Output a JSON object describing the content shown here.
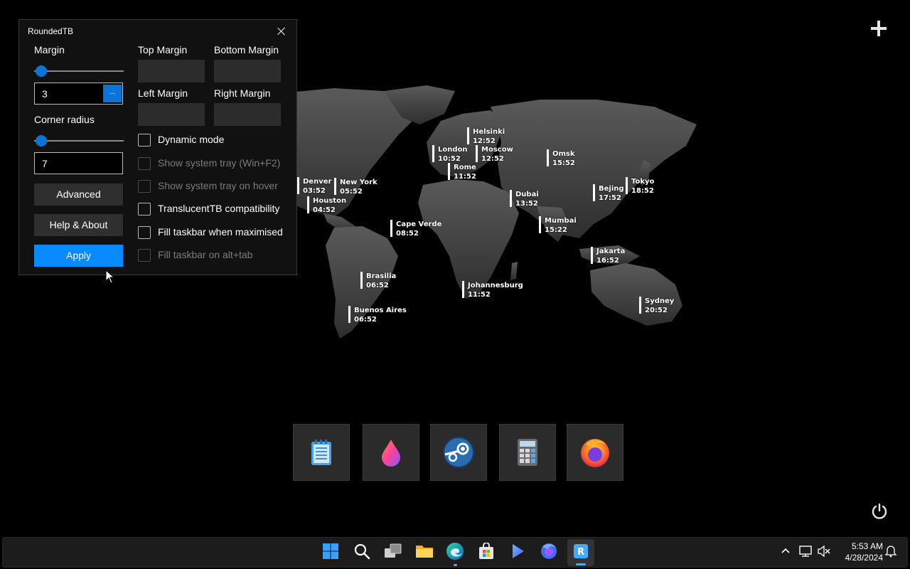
{
  "window": {
    "title": "RoundedTB",
    "margin_label": "Margin",
    "margin_value": "3",
    "margin_more_button": "...",
    "corner_radius_label": "Corner radius",
    "corner_radius_value": "7",
    "advanced_button": "Advanced",
    "help_button": "Help & About",
    "apply_button": "Apply",
    "top_margin_label": "Top Margin",
    "bottom_margin_label": "Bottom Margin",
    "left_margin_label": "Left Margin",
    "right_margin_label": "Right Margin",
    "options": [
      {
        "label": "Dynamic mode",
        "enabled": true,
        "checked": false
      },
      {
        "label": "Show system tray (Win+F2)",
        "enabled": false,
        "checked": false
      },
      {
        "label": "Show system tray on hover",
        "enabled": false,
        "checked": false
      },
      {
        "label": "TranslucentTB compatibility",
        "enabled": true,
        "checked": false
      },
      {
        "label": "Fill taskbar when maximised",
        "enabled": true,
        "checked": false
      },
      {
        "label": "Fill taskbar on alt+tab",
        "enabled": false,
        "checked": false
      }
    ]
  },
  "world_clock": [
    {
      "city": "Helsinki",
      "time": "12:52"
    },
    {
      "city": "London",
      "time": "10:52"
    },
    {
      "city": "Moscow",
      "time": "12:52"
    },
    {
      "city": "Omsk",
      "time": "15:52"
    },
    {
      "city": "Rome",
      "time": "11:52"
    },
    {
      "city": "Denver",
      "time": "03:52"
    },
    {
      "city": "New York",
      "time": "05:52"
    },
    {
      "city": "Tokyo",
      "time": "18:52"
    },
    {
      "city": "Bejing",
      "time": "17:52"
    },
    {
      "city": "Dubai",
      "time": "13:52"
    },
    {
      "city": "Houston",
      "time": "04:52"
    },
    {
      "city": "Cape Verde",
      "time": "08:52"
    },
    {
      "city": "Mumbai",
      "time": "15:22"
    },
    {
      "city": "Jakarta",
      "time": "16:52"
    },
    {
      "city": "Brasilia",
      "time": "06:52"
    },
    {
      "city": "Johannesburg",
      "time": "11:52"
    },
    {
      "city": "Sydney",
      "time": "20:52"
    },
    {
      "city": "Buenos Aires",
      "time": "06:52"
    }
  ],
  "dock": [
    "notepad-icon",
    "paint-drop-icon",
    "steam-icon",
    "calculator-icon",
    "firefox-icon"
  ],
  "taskbar": {
    "icons": [
      "windows-start-icon",
      "search-icon",
      "task-view-icon",
      "file-explorer-icon",
      "edge-icon",
      "store-icon",
      "media-player-icon",
      "firefox-icon",
      "roundedtb-icon"
    ],
    "tray_icons": [
      "chevron-up-icon",
      "network-icon",
      "volume-muted-icon",
      "notification-icon"
    ],
    "time": "5:53 AM",
    "date": "4/28/2024"
  },
  "colors": {
    "accent": "#0a8aff",
    "slider": "#0a74d9",
    "window_bg": "#111111",
    "map_land": "#4a4a4a"
  }
}
